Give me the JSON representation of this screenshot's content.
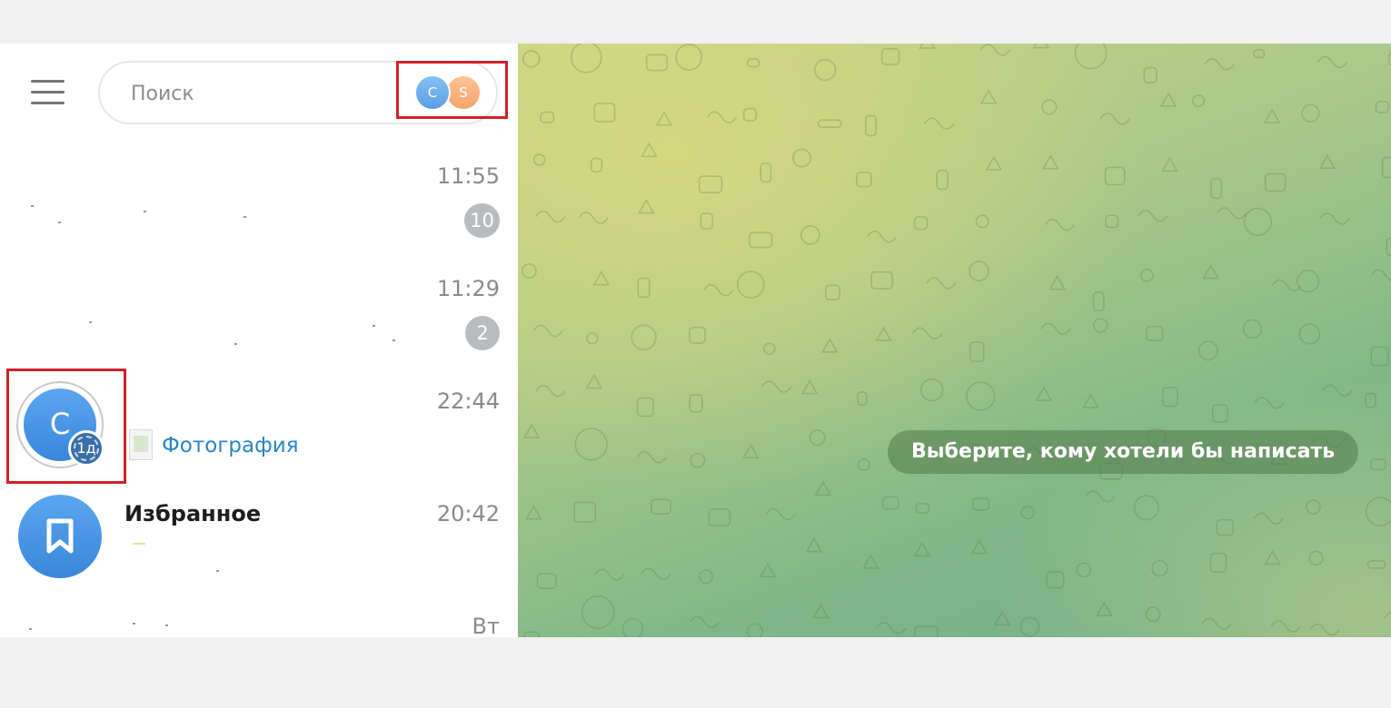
{
  "search": {
    "placeholder": "Поиск"
  },
  "stories": [
    {
      "letter": "C"
    },
    {
      "letter": "S"
    }
  ],
  "chats": [
    {
      "time": "11:55",
      "unread": "10"
    },
    {
      "time": "11:29",
      "unread": "2"
    },
    {
      "avatar_letter": "C",
      "story_age": "1д",
      "time": "22:44",
      "preview": "Фотография"
    },
    {
      "name": "Избранное",
      "time": "20:42"
    },
    {
      "time": "Вт"
    }
  ],
  "main": {
    "empty_hint": "Выберите, кому хотели бы написать"
  },
  "colors": {
    "accent": "#3a86db",
    "highlight": "#d0202a",
    "link": "#2a85c6",
    "chat_bg": "#a8c889"
  },
  "icons": {
    "menu": "hamburger-menu-icon",
    "saved": "bookmark-icon"
  }
}
